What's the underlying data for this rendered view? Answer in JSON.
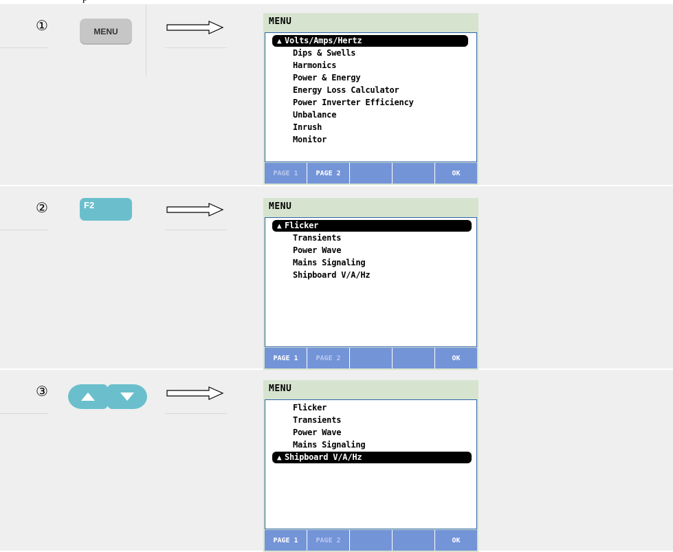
{
  "header_text": "p",
  "steps": [
    {
      "number": "①",
      "button_label": "MENU",
      "screen": {
        "title": "MENU",
        "items": [
          {
            "label": "Volts/Amps/Hertz",
            "selected": true
          },
          {
            "label": "Dips & Swells",
            "selected": false
          },
          {
            "label": "Harmonics",
            "selected": false
          },
          {
            "label": "Power & Energy",
            "selected": false
          },
          {
            "label": "Energy Loss Calculator",
            "selected": false
          },
          {
            "label": "Power Inverter Efficiency",
            "selected": false
          },
          {
            "label": "Unbalance",
            "selected": false
          },
          {
            "label": "Inrush",
            "selected": false
          },
          {
            "label": "Monitor",
            "selected": false
          }
        ],
        "softkeys": [
          {
            "label": "PAGE 1",
            "dim": true
          },
          {
            "label": "PAGE 2",
            "dim": false
          },
          {
            "label": "",
            "dim": false
          },
          {
            "label": "",
            "dim": false
          },
          {
            "label": "OK",
            "dim": false
          }
        ]
      }
    },
    {
      "number": "②",
      "button_label": "F2",
      "screen": {
        "title": "MENU",
        "items": [
          {
            "label": "Flicker",
            "selected": true
          },
          {
            "label": "Transients",
            "selected": false
          },
          {
            "label": "Power Wave",
            "selected": false
          },
          {
            "label": "Mains Signaling",
            "selected": false
          },
          {
            "label": "Shipboard V/A/Hz",
            "selected": false
          }
        ],
        "softkeys": [
          {
            "label": "PAGE 1",
            "dim": false
          },
          {
            "label": "PAGE 2",
            "dim": true
          },
          {
            "label": "",
            "dim": false
          },
          {
            "label": "",
            "dim": false
          },
          {
            "label": "OK",
            "dim": false
          }
        ]
      }
    },
    {
      "number": "③",
      "button_icons": [
        "up-triangle-icon",
        "down-triangle-icon"
      ],
      "screen": {
        "title": "MENU",
        "items": [
          {
            "label": "Flicker",
            "selected": false
          },
          {
            "label": "Transients",
            "selected": false
          },
          {
            "label": "Power Wave",
            "selected": false
          },
          {
            "label": "Mains Signaling",
            "selected": false
          },
          {
            "label": "Shipboard V/A/Hz",
            "selected": true
          }
        ],
        "softkeys": [
          {
            "label": "PAGE 1",
            "dim": false
          },
          {
            "label": "PAGE 2",
            "dim": true
          },
          {
            "label": "",
            "dim": false
          },
          {
            "label": "",
            "dim": false
          },
          {
            "label": "OK",
            "dim": false
          }
        ]
      }
    }
  ],
  "colors": {
    "row_background": "#efefef",
    "screen_title_bar": "#d6e4cf",
    "softkey_bar": "#7494d8",
    "key_button_teal": "#6bbfcd",
    "menu_button_gray": "#c6c6c6"
  }
}
